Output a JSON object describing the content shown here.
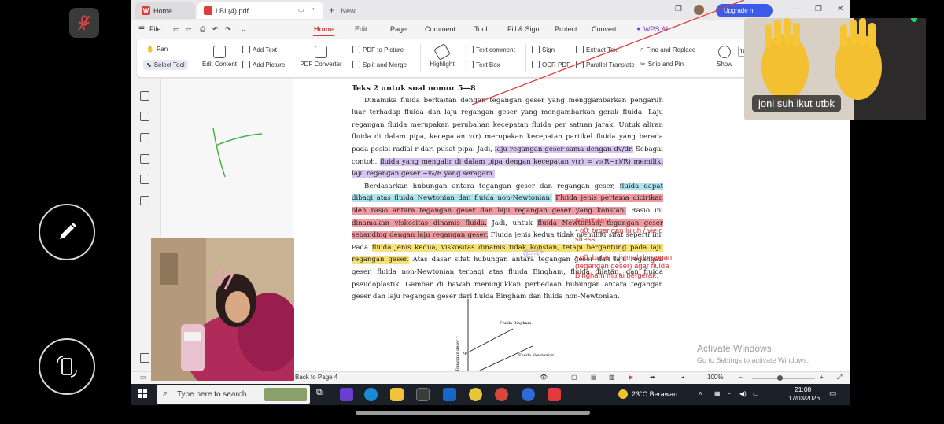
{
  "browser": {
    "home_tab": "Home",
    "doc_tab": "LBI (4).pdf",
    "new_tab": "New",
    "upgrade": "Upgrade n"
  },
  "menu": {
    "file": "File",
    "items": [
      "Home",
      "Edit",
      "Page",
      "Comment",
      "Tool",
      "Fill & Sign",
      "Protect",
      "Convert",
      "WPS AI"
    ]
  },
  "ribbon": {
    "pan": "Pan",
    "select_tool": "Select Tool",
    "edit_content": "Edit Content",
    "add_text": "Add Text",
    "add_picture": "Add Picture",
    "pdf_converter": "PDF Converter",
    "pdf_to_picture": "PDF to Picture",
    "split_merge": "Split and Merge",
    "highlight": "Highlight",
    "text_comment": "Text comment",
    "text_box": "Text Box",
    "sign": "Sign",
    "ocr_pdf": "OCR PDF",
    "extract_text": "Extract Text",
    "parallel_translate": "Parallel Translate",
    "find_replace": "Find and Replace",
    "snip_pin": "Snip and Pin",
    "show": "Show",
    "zoom_field": "10"
  },
  "document": {
    "title": "Teks 2 untuk soal nomor 5—8",
    "p1_a": "Dinamika fluida berkaitan dengan tegangan geser yang menggambarkan pengaruh luar terhadap fluida dan laju regangan geser yang mengambarkan gerak fluida. Laju regangan fluida merupakan perubahan kecepatan fluida per satuan jarak. Untuk aliran fluida di dalam pipa, kecepatan v(r) merupakan kecepatan partikel fluida yang berada pada posisi radial r dari pusat pipa. Jadi,",
    "p1_h1": "laju regangan geser sama dengan dv/dr.",
    "p1_b": "Sebagai contoh,",
    "p1_h2": "fluida yang mengalir di dalam pipa dengan kecepatan v(r) = v₀(R−r)/R) memiliki laju regangan geser −v₀/R yang seragam.",
    "p2_a": "Berdasarkan hubungan antara tegangan geser dan regangan geser,",
    "p2_h1": "fluida dapat dibagi atas fluida Newtonian dan fluida non-Newtonian.",
    "p2_h2": "Fluida jenis pertama dicirikan oleh rasio antara tegangan geser dan laju regangan geser yang konstan.",
    "p2_b": "Rasio ini",
    "p2_h3": "dinamakan viskositas dinamis fluida.",
    "p2_c": "Jadi, untuk",
    "p2_h4": "fluida Newtonian, tegangan geser sebanding dengan laju regangan geser.",
    "p2_d": "Fluida jenis kedua tidak memiliki sifat seperti ini. Pada",
    "p2_h5": "fluida jenis kedua, viskositas dinamis tidak konstan, tetapi bergantung pada laju regangan geser.",
    "p2_e": "Atas dasar sifat hubungan antara tegangan geser dan laju regangan geser, fluida non-Newtonian terbagi atas fluida Bingham, fluida dilatan, dan fluida pseudoplastik. Gambar di bawah menunjukkan perbedaan hubungan antara tegangan geser dan laju regangan geser dari fluida Bingham dan fluida non-Newtonian.",
    "chart_label1": "Fluida Bingham",
    "chart_label2": "Fluida Newtonian",
    "chart_ylabel": "Tegangan geser τ",
    "chart_q": "q₀",
    "note": [
      "PENTING!",
      "• q0: tegangan luluh / yield stress",
      "",
      "• q0: batas minimal dorongan (tegangan geser) agar fluida Bingham mulai bergerak."
    ]
  },
  "status": {
    "back_to_page": "Back to Page 4",
    "zoom": "100%"
  },
  "windows": {
    "activate_title": "Activate Windows",
    "activate_sub": "Go to Settings to activate Windows.",
    "search_placeholder": "Type here to search",
    "weather": "23°C  Berawan",
    "time": "21:08",
    "date": "17/03/2026"
  },
  "meeting": {
    "participant_name": "joni suh ikut utbk"
  },
  "colors": {
    "accent_red": "#d73a3a",
    "upgrade_blue": "#3b5be8",
    "highlight_purple": "#d7c4f0",
    "highlight_blue": "#aee3f0",
    "highlight_red": "#ee9aa0",
    "highlight_yellow": "#f7e27a",
    "annotation_line": "#e23b3b",
    "pen_green": "#3cb043"
  }
}
